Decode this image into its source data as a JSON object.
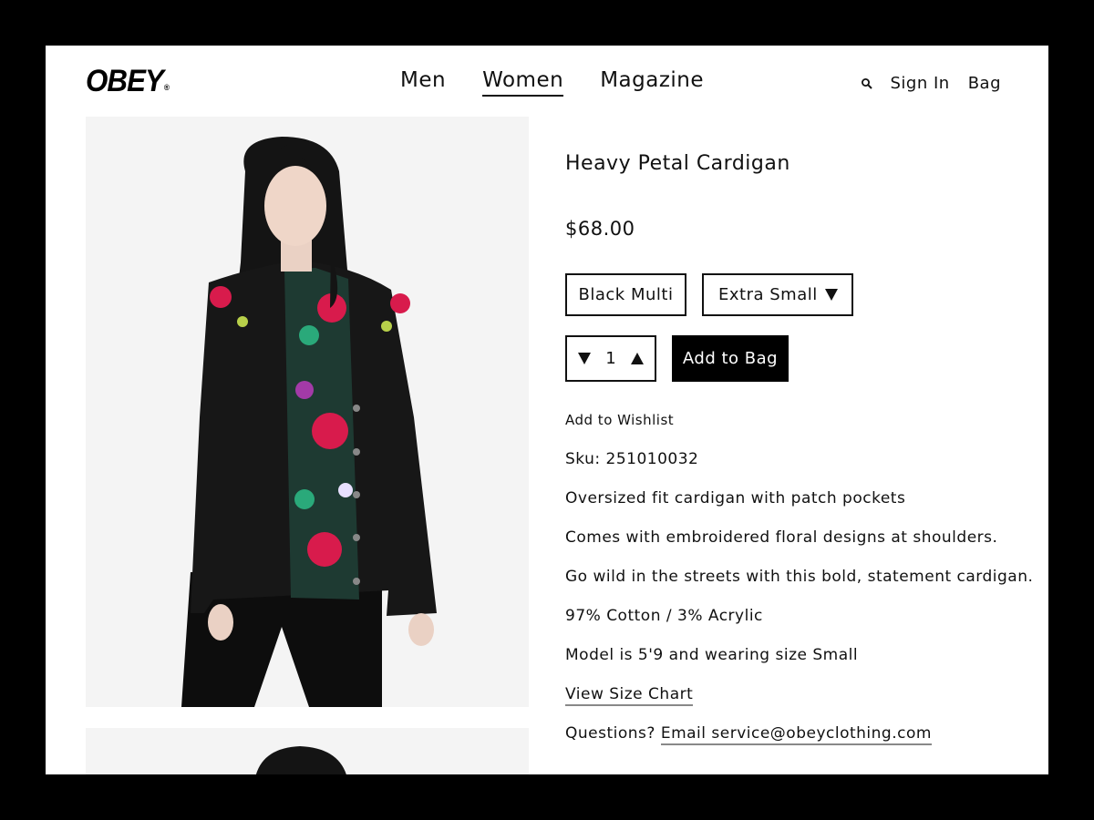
{
  "header": {
    "logo": "OBEY",
    "logo_mark": "®",
    "nav": [
      {
        "label": "Men",
        "active": false
      },
      {
        "label": "Women",
        "active": true
      },
      {
        "label": "Magazine",
        "active": false
      }
    ],
    "sign_in": "Sign In",
    "bag": "Bag",
    "search_icon": "search-icon"
  },
  "product": {
    "title": "Heavy Petal Cardigan",
    "price": "$68.00",
    "color": "Black Multi",
    "size": "Extra Small",
    "quantity": "1",
    "add_to_bag": "Add to Bag",
    "add_to_wishlist": "Add to Wishlist",
    "sku": "Sku: 251010032",
    "details": [
      "Oversized fit cardigan with patch pockets",
      "Comes with embroidered floral designs at shoulders.",
      "Go wild in the streets with this bold, statement cardigan.",
      "97% Cotton / 3% Acrylic",
      "Model is 5'9 and wearing size Small"
    ],
    "size_chart": "View Size Chart",
    "questions_label": "Questions?",
    "email_link": "Email service@obeyclothing.com"
  },
  "colors": {
    "accent": "#000000",
    "page_bg": "#ffffff",
    "photo_bg": "#f4f4f4",
    "floral_red": "#d81b4c",
    "floral_green": "#2aa97a"
  }
}
